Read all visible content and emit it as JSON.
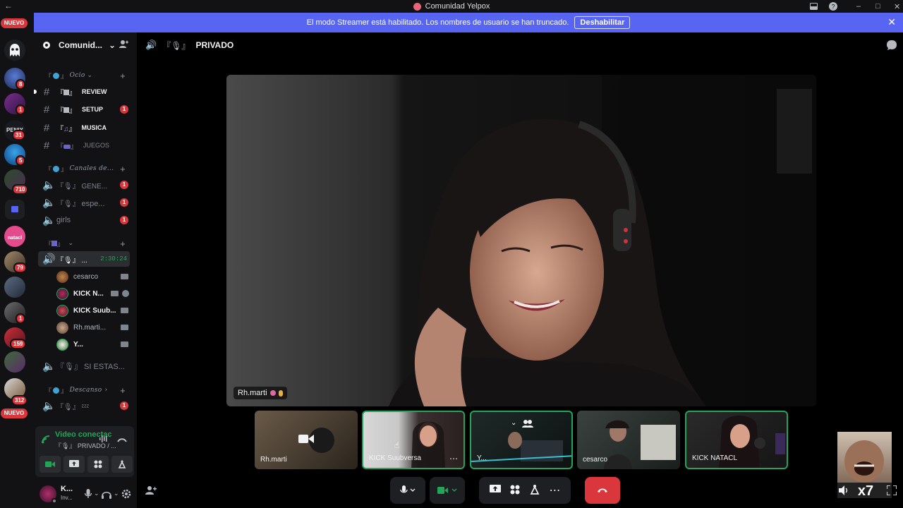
{
  "window": {
    "title": "Comunidad Yelpox"
  },
  "banner": {
    "message": "El modo Streamer está habilitado. Los nombres de usuario se han truncado.",
    "button": "Deshabilitar"
  },
  "rail": {
    "nuevo_top": "NUEVO",
    "nuevo_bottom": "NUEVO",
    "badges": [
      "8",
      "1",
      "31",
      "5",
      "710",
      "79",
      "1",
      "159",
      "312"
    ]
  },
  "server": {
    "name": "Comunid..."
  },
  "channels": {
    "cat1": "『🌏』𝒟𝒸𝒾𝑜",
    "cat1_label": "Ocio",
    "review": "REVIEW",
    "setup": "SETUP",
    "setup_badge": "1",
    "musica": "MUSICA",
    "juegos": "JUEGOS",
    "cat2_label": "Canales de...",
    "gene": "GENE...",
    "gene_badge": "1",
    "espe": "espe...",
    "espe_badge": "1",
    "girls": "girls",
    "girls_badge": "1",
    "active": "...",
    "active_time": "2:30:24",
    "si_estas": "SI ESTAS...",
    "cat4_label": "Descanso",
    "zz": "ᶻᶻᶻ",
    "zz_badge": "1"
  },
  "members": [
    "cesarco",
    "KICK N...",
    "KICK Suub...",
    "Rh.marti...",
    "Y..."
  ],
  "voice": {
    "status": "Video conectac",
    "channel": "『🎙』 PRIVADO / ..."
  },
  "user": {
    "name": "K...",
    "status": "Inv..."
  },
  "header": {
    "channel": "PRIVADO"
  },
  "stage": {
    "name_tag": "Rh.marti"
  },
  "tiles": [
    {
      "name": "Rh.marti"
    },
    {
      "name": "KICK Suubversa"
    },
    {
      "name": "Y..."
    },
    {
      "name": "cesarco"
    },
    {
      "name": "KICK NATACL"
    }
  ],
  "colors": {
    "accent": "#5865f2",
    "danger": "#da373c",
    "online": "#23a559"
  }
}
